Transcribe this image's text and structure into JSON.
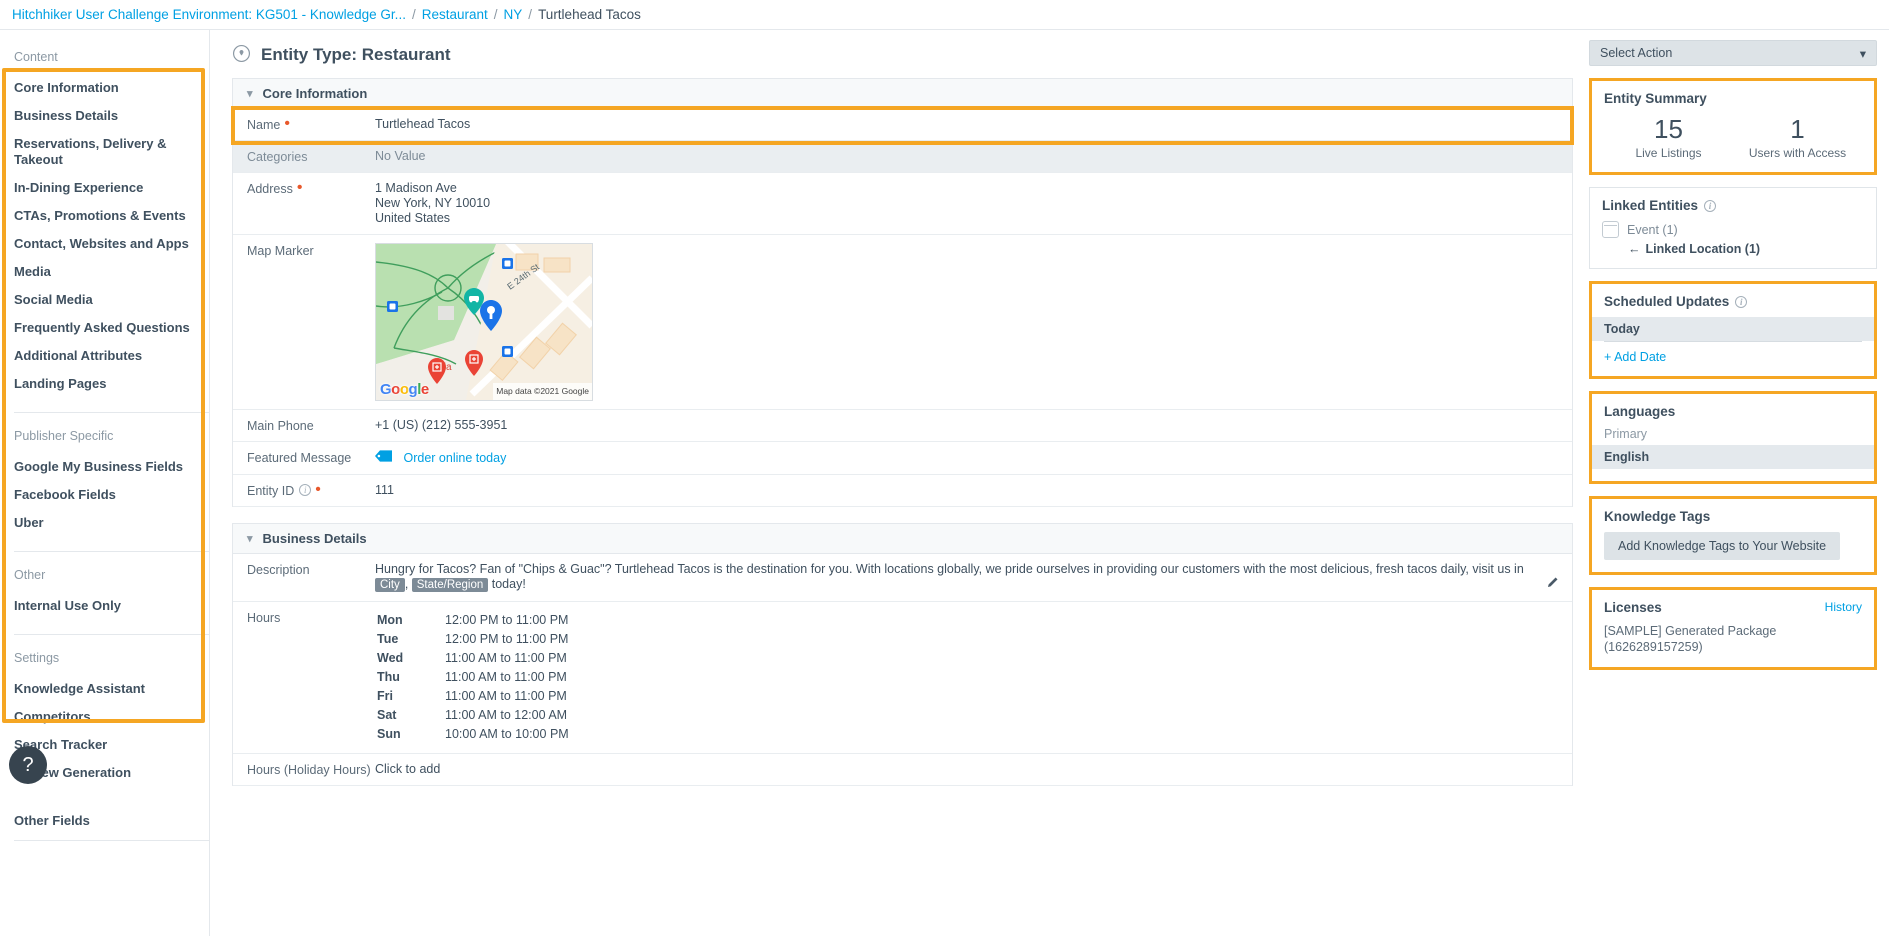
{
  "breadcrumb": {
    "root": "Hitchhiker User Challenge Environment: KG501 - Knowledge Gr...",
    "level2": "Restaurant",
    "level3": "NY",
    "current": "Turtlehead Tacos",
    "sep": "/"
  },
  "page": {
    "title": "Entity Type: Restaurant",
    "pin_icon": "location-pin-icon"
  },
  "sidebar": {
    "groups": [
      {
        "label": "Content",
        "items": [
          "Core Information",
          "Business Details",
          "Reservations, Delivery & Takeout",
          "In-Dining Experience",
          "CTAs, Promotions & Events",
          "Contact, Websites and Apps",
          "Media",
          "Social Media",
          "Frequently Asked Questions",
          "Additional Attributes",
          "Landing Pages"
        ]
      },
      {
        "label": "Publisher Specific",
        "items": [
          "Google My Business Fields",
          "Facebook Fields",
          "Uber"
        ]
      },
      {
        "label": "Other",
        "items": [
          "Internal Use Only"
        ]
      },
      {
        "label": "Settings",
        "items": [
          "Knowledge Assistant",
          "Competitors",
          "Search Tracker",
          "Review Generation"
        ]
      }
    ],
    "other_fields": "Other Fields",
    "help_glyph": "?"
  },
  "core_information": {
    "section_title": "Core Information",
    "name_label": "Name",
    "name_value": "Turtlehead Tacos",
    "categories_label": "Categories",
    "categories_value": "No Value",
    "address_label": "Address",
    "address_lines": [
      "1 Madison Ave",
      "New York, NY 10010",
      "United States"
    ],
    "map_marker_label": "Map Marker",
    "map_attribution": "Map data ©2021 Google",
    "map_place_label": "Tia",
    "main_phone_label": "Main Phone",
    "main_phone_value": "+1 (US) (212) 555-3951",
    "featured_message_label": "Featured Message",
    "featured_message_value": "Order online today",
    "entity_id_label": "Entity ID",
    "entity_id_value": "111"
  },
  "business_details": {
    "section_title": "Business Details",
    "description_label": "Description",
    "description_part1": "Hungry for Tacos? Fan of \"Chips & Guac\"? Turtlehead Tacos is the destination for you. With locations globally, we pride ourselves in providing our customers with the most delicious, fresh tacos daily, visit us in ",
    "description_token1": "City",
    "description_mid": ", ",
    "description_token2": "State/Region",
    "description_part2": " today!",
    "hours_label": "Hours",
    "hours": [
      {
        "day": "Mon",
        "time": "12:00 PM to 11:00 PM"
      },
      {
        "day": "Tue",
        "time": "12:00 PM to 11:00 PM"
      },
      {
        "day": "Wed",
        "time": "11:00 AM to 11:00 PM"
      },
      {
        "day": "Thu",
        "time": "11:00 AM to 11:00 PM"
      },
      {
        "day": "Fri",
        "time": "11:00 AM to 11:00 PM"
      },
      {
        "day": "Sat",
        "time": "11:00 AM to 12:00 AM"
      },
      {
        "day": "Sun",
        "time": "10:00 AM to 10:00 PM"
      }
    ],
    "holiday_hours_label": "Hours (Holiday Hours)",
    "holiday_hours_value": "Click to add"
  },
  "rail": {
    "select_action": "Select Action",
    "entity_summary": {
      "title": "Entity Summary",
      "stats": [
        {
          "value": "15",
          "label": "Live Listings"
        },
        {
          "value": "1",
          "label": "Users with Access"
        }
      ]
    },
    "linked_entities": {
      "title": "Linked Entities",
      "event": "Event (1)",
      "linked_location": "Linked Location (1)"
    },
    "scheduled_updates": {
      "title": "Scheduled Updates",
      "today": "Today",
      "add_date": "+ Add Date"
    },
    "languages": {
      "title": "Languages",
      "primary_label": "Primary",
      "primary_value": "English"
    },
    "knowledge_tags": {
      "title": "Knowledge Tags",
      "button": "Add Knowledge Tags to Your Website"
    },
    "licenses": {
      "title": "Licenses",
      "history": "History",
      "text": "[SAMPLE] Generated Package (1626289157259)"
    }
  },
  "colors": {
    "accent_highlight": "#f5a623",
    "link": "#00a0e3",
    "text": "#3f505f",
    "required": "#e8582b"
  }
}
